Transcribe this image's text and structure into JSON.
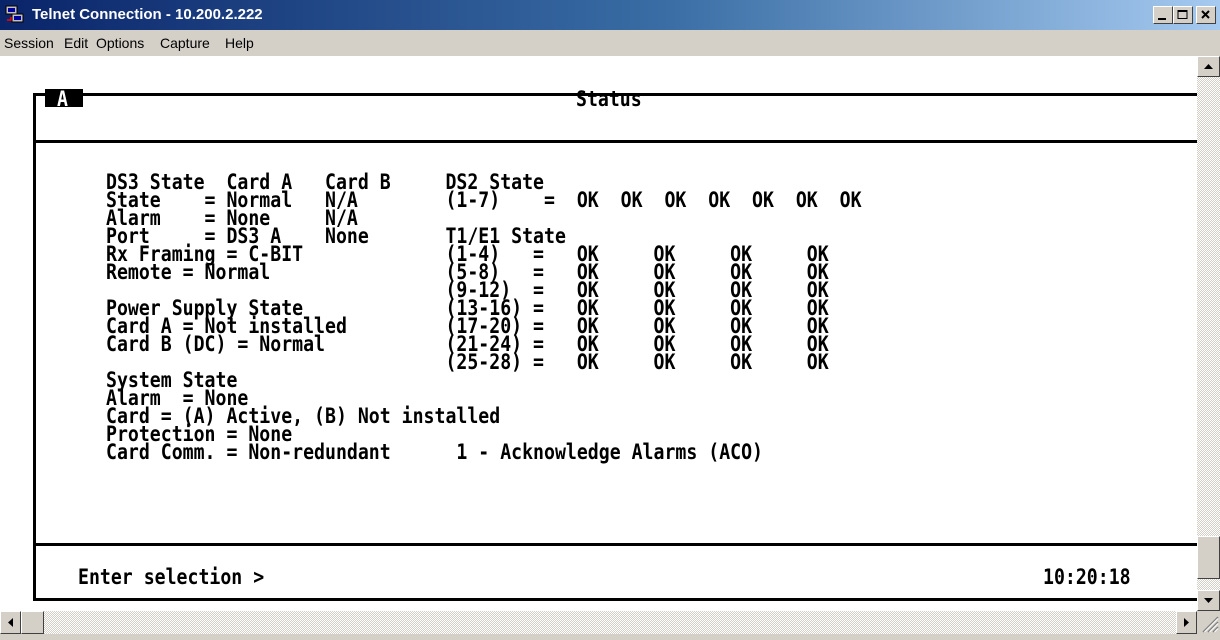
{
  "window": {
    "title": "Telnet Connection - 10.200.2.222"
  },
  "menu": [
    "Session",
    "Edit",
    "Options",
    "Capture",
    "Help"
  ],
  "screen": {
    "tab": "A",
    "header": "Status",
    "lines": [
      "DS3 State  Card A   Card B     DS2 State",
      "State    = Normal   N/A        (1-7)    =  OK  OK  OK  OK  OK  OK  OK",
      "Alarm    = None     N/A",
      "Port     = DS3 A    None       T1/E1 State",
      "Rx Framing = C-BIT             (1-4)   =   OK     OK     OK     OK",
      "Remote = Normal                (5-8)   =   OK     OK     OK     OK",
      "                               (9-12)  =   OK     OK     OK     OK",
      "Power Supply State             (13-16) =   OK     OK     OK     OK",
      "Card A = Not installed         (17-20) =   OK     OK     OK     OK",
      "Card B (DC) = Normal           (21-24) =   OK     OK     OK     OK",
      "                               (25-28) =   OK     OK     OK     OK",
      "System State",
      "Alarm  = None",
      "Card = (A) Active, (B) Not installed",
      "Protection = None",
      "Card Comm. = Non-redundant      1 - Acknowledge Alarms (ACO)"
    ],
    "prompt": "Enter selection >",
    "time": "10:20:18"
  }
}
